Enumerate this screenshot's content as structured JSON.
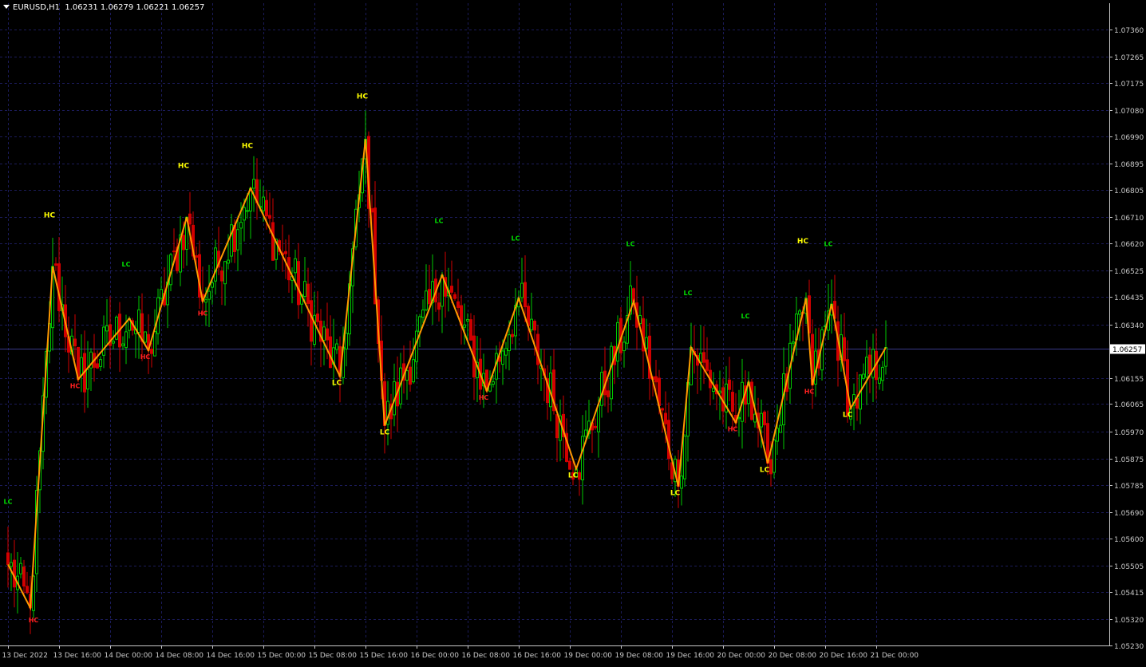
{
  "header": {
    "symbol": "EURUSD,H1",
    "ohlc": "1.06231 1.06279 1.06221 1.06257"
  },
  "colors": {
    "background": "#000000",
    "grid": "#1b1b5a",
    "axis": "#c8c8c8",
    "bull": "#00c800",
    "bear": "#d20000",
    "zigzag": "#ff9900",
    "label_hc_high": "#ffff00",
    "label_hc_low": "#ff2020",
    "label_lc_high": "#00dd00",
    "label_lc_low": "#ffff00",
    "price_marker_bg": "#ffffff",
    "price_marker_text": "#000000"
  },
  "chart_data": {
    "type": "candlestick",
    "symbol": "EURUSD",
    "timeframe": "H1",
    "ylim": [
      1.0523,
      1.0745
    ],
    "y_ticks": [
      "1.07360",
      "1.07265",
      "1.07175",
      "1.07080",
      "1.06990",
      "1.06895",
      "1.06805",
      "1.06710",
      "1.06620",
      "1.06525",
      "1.06435",
      "1.06340",
      "1.06155",
      "1.06065",
      "1.05970",
      "1.05875",
      "1.05785",
      "1.05690",
      "1.05600",
      "1.05505",
      "1.05415",
      "1.05320",
      "1.05230"
    ],
    "x_ticks": [
      {
        "index": 0,
        "label": "13 Dec 2022"
      },
      {
        "index": 16,
        "label": "13 Dec 16:00"
      },
      {
        "index": 32,
        "label": "14 Dec 00:00"
      },
      {
        "index": 48,
        "label": "14 Dec 08:00"
      },
      {
        "index": 64,
        "label": "14 Dec 16:00"
      },
      {
        "index": 80,
        "label": "15 Dec 00:00"
      },
      {
        "index": 96,
        "label": "15 Dec 08:00"
      },
      {
        "index": 112,
        "label": "15 Dec 16:00"
      },
      {
        "index": 128,
        "label": "16 Dec 00:00"
      },
      {
        "index": 144,
        "label": "16 Dec 08:00"
      },
      {
        "index": 160,
        "label": "16 Dec 16:00"
      },
      {
        "index": 176,
        "label": "19 Dec 00:00"
      },
      {
        "index": 192,
        "label": "19 Dec 08:00"
      },
      {
        "index": 208,
        "label": "19 Dec 16:00"
      },
      {
        "index": 224,
        "label": "20 Dec 00:00"
      },
      {
        "index": 240,
        "label": "20 Dec 08:00"
      },
      {
        "index": 256,
        "label": "20 Dec 16:00"
      },
      {
        "index": 272,
        "label": "21 Dec 00:00"
      }
    ],
    "bar_count": 276,
    "current_price": "1.06257",
    "pivots": [
      {
        "index": 0,
        "price": 1.0551
      },
      {
        "index": 7,
        "price": 1.0536
      },
      {
        "index": 14,
        "price": 1.0654
      },
      {
        "index": 22,
        "price": 1.0615
      },
      {
        "index": 38,
        "price": 1.0636
      },
      {
        "index": 44,
        "price": 1.0625
      },
      {
        "index": 56,
        "price": 1.0671
      },
      {
        "index": 61,
        "price": 1.0642
      },
      {
        "index": 76,
        "price": 1.0681
      },
      {
        "index": 104,
        "price": 1.0616
      },
      {
        "index": 112,
        "price": 1.0698
      },
      {
        "index": 118,
        "price": 1.0599
      },
      {
        "index": 136,
        "price": 1.0651
      },
      {
        "index": 150,
        "price": 1.0611
      },
      {
        "index": 160,
        "price": 1.0643
      },
      {
        "index": 178,
        "price": 1.0584
      },
      {
        "index": 196,
        "price": 1.0642
      },
      {
        "index": 210,
        "price": 1.0578
      },
      {
        "index": 214,
        "price": 1.0626
      },
      {
        "index": 228,
        "price": 1.06
      },
      {
        "index": 232,
        "price": 1.0614
      },
      {
        "index": 238,
        "price": 1.0586
      },
      {
        "index": 250,
        "price": 1.0643
      },
      {
        "index": 252,
        "price": 1.0613
      },
      {
        "index": 258,
        "price": 1.0641
      },
      {
        "index": 264,
        "price": 1.0605
      },
      {
        "index": 275,
        "price": 1.0626
      }
    ],
    "markers": [
      {
        "text": "LC",
        "index": 0,
        "price": 1.0572,
        "style": "lc_high"
      },
      {
        "text": "HC",
        "index": 8,
        "price": 1.0531,
        "style": "hc_low"
      },
      {
        "text": "HC",
        "index": 13,
        "price": 1.0671,
        "style": "hc_high"
      },
      {
        "text": "HC",
        "index": 21,
        "price": 1.0612,
        "style": "hc_low"
      },
      {
        "text": "LC",
        "index": 37,
        "price": 1.0654,
        "style": "lc_high"
      },
      {
        "text": "HC",
        "index": 43,
        "price": 1.0622,
        "style": "hc_low"
      },
      {
        "text": "HC",
        "index": 55,
        "price": 1.0688,
        "style": "hc_high"
      },
      {
        "text": "HC",
        "index": 61,
        "price": 1.0637,
        "style": "hc_low"
      },
      {
        "text": "HC",
        "index": 75,
        "price": 1.0695,
        "style": "hc_high"
      },
      {
        "text": "LC",
        "index": 103,
        "price": 1.0613,
        "style": "lc_low"
      },
      {
        "text": "HC",
        "index": 111,
        "price": 1.0712,
        "style": "hc_high"
      },
      {
        "text": "LC",
        "index": 118,
        "price": 1.0596,
        "style": "lc_low"
      },
      {
        "text": "LC",
        "index": 135,
        "price": 1.0669,
        "style": "lc_high"
      },
      {
        "text": "HC",
        "index": 149,
        "price": 1.0608,
        "style": "hc_low"
      },
      {
        "text": "LC",
        "index": 159,
        "price": 1.0663,
        "style": "lc_high"
      },
      {
        "text": "LC",
        "index": 177,
        "price": 1.0581,
        "style": "lc_low"
      },
      {
        "text": "LC",
        "index": 195,
        "price": 1.0661,
        "style": "lc_high"
      },
      {
        "text": "LC",
        "index": 209,
        "price": 1.0575,
        "style": "lc_low"
      },
      {
        "text": "LC",
        "index": 213,
        "price": 1.0644,
        "style": "lc_high"
      },
      {
        "text": "HC",
        "index": 227,
        "price": 1.0597,
        "style": "hc_low"
      },
      {
        "text": "LC",
        "index": 231,
        "price": 1.0636,
        "style": "lc_high"
      },
      {
        "text": "LC",
        "index": 237,
        "price": 1.0583,
        "style": "lc_low"
      },
      {
        "text": "HC",
        "index": 249,
        "price": 1.0662,
        "style": "hc_high"
      },
      {
        "text": "HC",
        "index": 251,
        "price": 1.061,
        "style": "hc_low"
      },
      {
        "text": "LC",
        "index": 257,
        "price": 1.0661,
        "style": "lc_high"
      },
      {
        "text": "LC",
        "index": 263,
        "price": 1.0602,
        "style": "lc_low"
      }
    ]
  }
}
